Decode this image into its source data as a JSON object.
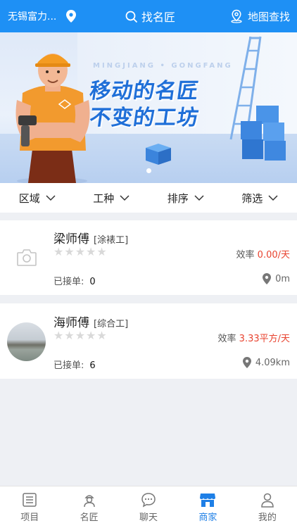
{
  "header": {
    "location": "无锡富力...",
    "search_label": "找名匠",
    "map_label": "地图查找"
  },
  "banner": {
    "eng_text": "MINGJIANG • GONGFANG",
    "line1": "移动的名匠",
    "line2": "不变的工坊",
    "slide_index": 1,
    "slide_count": 1
  },
  "filters": [
    "区域",
    "工种",
    "排序",
    "筛选"
  ],
  "workers": [
    {
      "name": "梁师傅",
      "trade": "[涂裱工]",
      "rating": 0,
      "efficiency_label": "效率",
      "efficiency_value": "0.00/天",
      "orders_label": "已接单:",
      "orders": "0",
      "distance": "0m"
    },
    {
      "name": "海师傅",
      "trade": "[综合工]",
      "rating": 0,
      "efficiency_label": "效率",
      "efficiency_value": "3.33平方/天",
      "orders_label": "已接单:",
      "orders": "6",
      "distance": "4.09km"
    }
  ],
  "nav": [
    {
      "label": "项目",
      "icon": "list-icon"
    },
    {
      "label": "名匠",
      "icon": "worker-icon"
    },
    {
      "label": "聊天",
      "icon": "chat-icon"
    },
    {
      "label": "商家",
      "icon": "shop-icon"
    },
    {
      "label": "我的",
      "icon": "user-icon"
    }
  ],
  "colors": {
    "primary": "#1e90f5",
    "accent_red": "#e8432f",
    "nav_active": "#1e7fe6"
  }
}
